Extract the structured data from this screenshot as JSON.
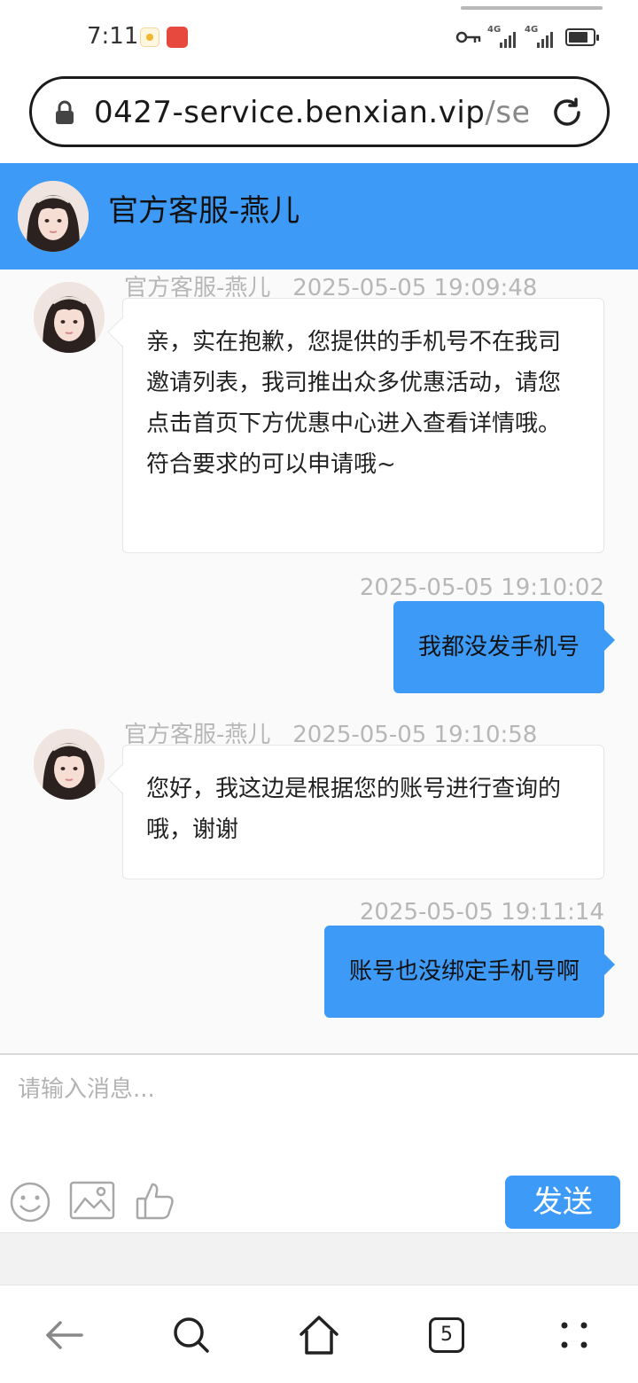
{
  "status_bar": {
    "time": "7:11",
    "network_1": "4G",
    "network_2": "4G",
    "battery_level": 0.8,
    "icons": [
      "app-notification-icon",
      "huawei-store-icon",
      "vpn-key-icon",
      "signal-icon",
      "signal-icon",
      "battery-icon"
    ]
  },
  "browser": {
    "url_main": "0427-service.benxian.vip",
    "url_rest": "/serv",
    "icons": [
      "lock-icon",
      "reload-icon"
    ]
  },
  "chat": {
    "header_title": "官方客服-燕儿",
    "messages": [
      {
        "direction": "incoming",
        "sender": "官方客服-燕儿",
        "time": "2025-05-05 19:09:48",
        "text": "亲，实在抱歉，您提供的手机号不在我司邀请列表，我司推出众多优惠活动，请您点击首页下方优惠中心进入查看详情哦。符合要求的可以申请哦~"
      },
      {
        "direction": "outgoing",
        "time": "2025-05-05 19:10:02",
        "text": "我都没发手机号"
      },
      {
        "direction": "incoming",
        "sender": "官方客服-燕儿",
        "time": "2025-05-05 19:10:58",
        "text": "您好，我这边是根据您的账号进行查询的哦，谢谢"
      },
      {
        "direction": "outgoing",
        "time": "2025-05-05 19:11:14",
        "text": "账号也没绑定手机号啊"
      }
    ]
  },
  "composer": {
    "placeholder": "请输入消息...",
    "send_label": "发送",
    "icons": [
      "emoji-icon",
      "image-icon",
      "thumbs-up-icon"
    ]
  },
  "bottom_nav": {
    "tab_count": "5",
    "icons": [
      "back-icon",
      "search-icon",
      "home-icon",
      "tabs-icon",
      "more-icon"
    ]
  },
  "colors": {
    "accent": "#3d9bf7",
    "meta_text": "#b7b7b7",
    "chat_background": "#fafafa"
  }
}
